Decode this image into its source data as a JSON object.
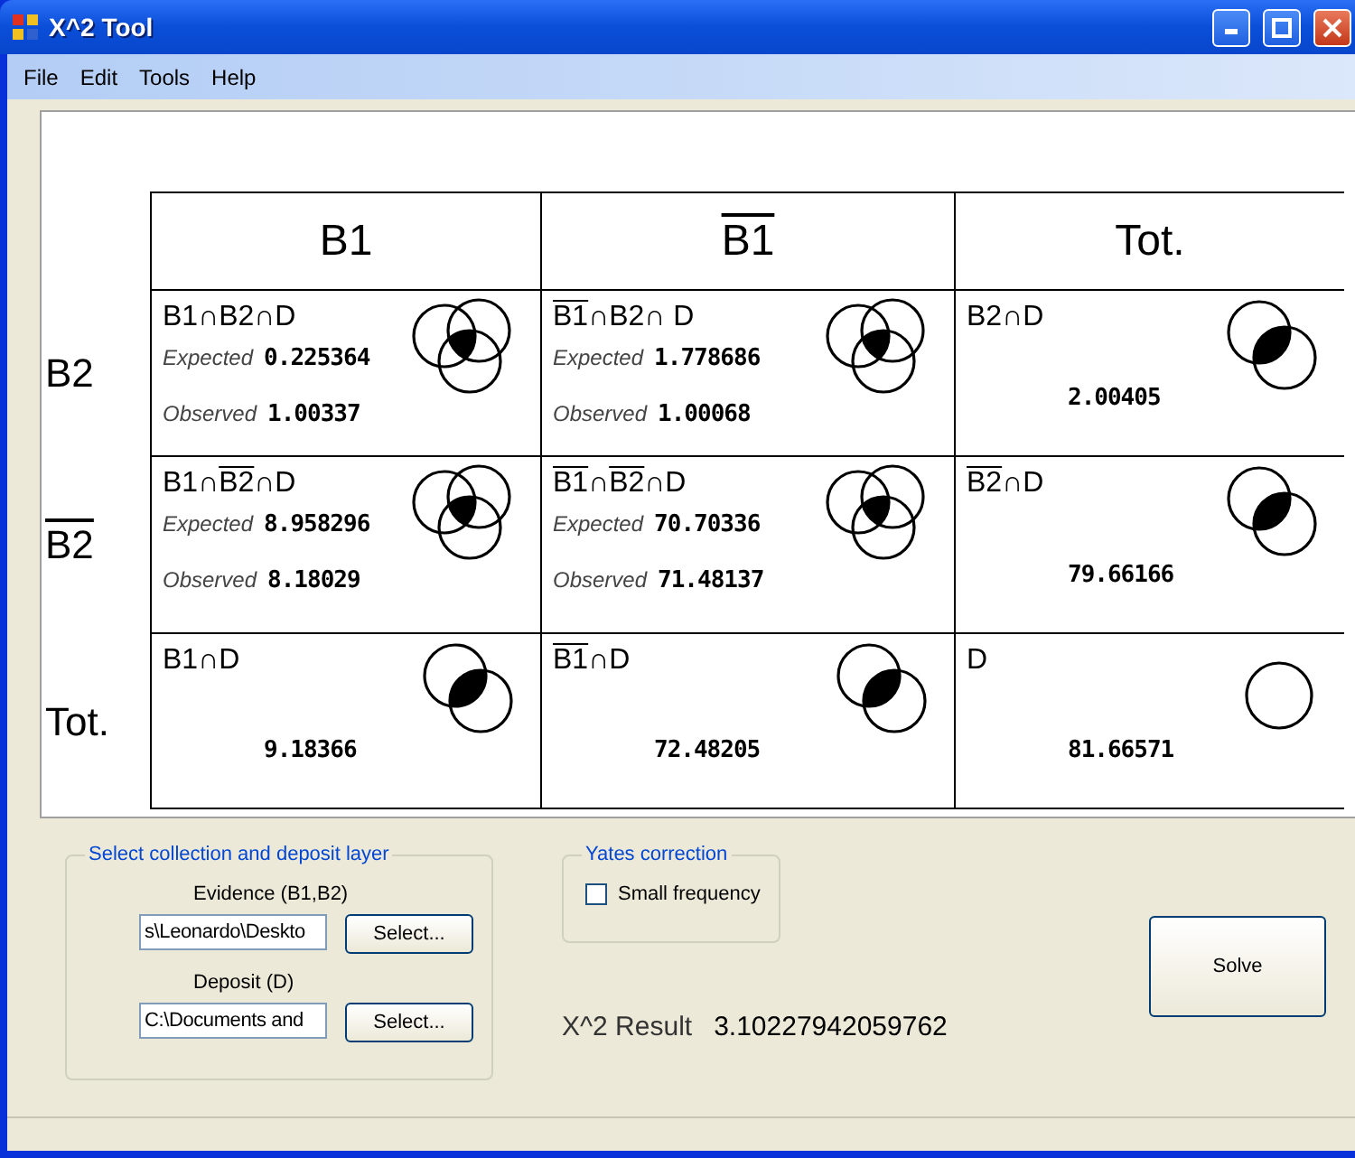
{
  "window": {
    "title": "X^2 Tool"
  },
  "menu": [
    "File",
    "Edit",
    "Tools",
    "Help"
  ],
  "column_headers": [
    [
      {
        "text": "B1"
      }
    ],
    [
      {
        "text": "B1",
        "bar": true
      }
    ],
    [
      {
        "text": "Tot."
      }
    ]
  ],
  "table": {
    "rows": [
      {
        "label": [
          {
            "text": "B2"
          }
        ],
        "cells": [
          {
            "kind": "observed",
            "diagram": {
              "kind": "triple"
            },
            "label": [
              {
                "text": "B1∩B2∩D"
              }
            ],
            "expected_label": "Expected",
            "expected": "0.225364",
            "observed_label": "Observed",
            "observed": "1.00337"
          },
          {
            "kind": "observed",
            "diagram": {
              "kind": "triple"
            },
            "label": [
              {
                "text": "B1",
                "bar": true
              },
              {
                "text": "∩B2∩ D"
              }
            ],
            "expected_label": "Expected",
            "expected": "1.778686",
            "observed_label": "Observed",
            "observed": "1.00068"
          },
          {
            "kind": "total",
            "diagram": {
              "kind": "double"
            },
            "label": [
              {
                "text": "B2∩D"
              }
            ],
            "value": "2.00405"
          }
        ]
      },
      {
        "label": [
          {
            "text": "B2",
            "bar": true
          }
        ],
        "cells": [
          {
            "kind": "observed",
            "diagram": {
              "kind": "triple"
            },
            "label": [
              {
                "text": "B1∩"
              },
              {
                "text": "B2",
                "bar": true
              },
              {
                "text": "∩D"
              }
            ],
            "expected_label": "Expected",
            "expected": "8.958296",
            "observed_label": "Observed",
            "observed": "8.18029"
          },
          {
            "kind": "observed",
            "diagram": {
              "kind": "triple"
            },
            "label": [
              {
                "text": "B1",
                "bar": true
              },
              {
                "text": "∩"
              },
              {
                "text": "B2",
                "bar": true
              },
              {
                "text": "∩D"
              }
            ],
            "expected_label": "Expected",
            "expected": "70.70336",
            "observed_label": "Observed",
            "observed": "71.48137"
          },
          {
            "kind": "total",
            "diagram": {
              "kind": "double"
            },
            "label": [
              {
                "text": "B2",
                "bar": true
              },
              {
                "text": "∩D"
              }
            ],
            "value": "79.66166"
          }
        ]
      },
      {
        "label": [
          {
            "text": "Tot."
          }
        ],
        "cells": [
          {
            "kind": "total",
            "diagram": {
              "kind": "double"
            },
            "label": [
              {
                "text": "B1∩D"
              }
            ],
            "value": "9.18366"
          },
          {
            "kind": "total",
            "diagram": {
              "kind": "double"
            },
            "label": [
              {
                "text": "B1",
                "bar": true
              },
              {
                "text": "∩D"
              }
            ],
            "value": "72.48205"
          },
          {
            "kind": "total",
            "diagram": {
              "kind": "single"
            },
            "label": [
              {
                "text": "D"
              }
            ],
            "value": "81.66571"
          }
        ]
      }
    ]
  },
  "layer_group": {
    "title": "Select collection and deposit layer",
    "fields": [
      {
        "label": "Evidence (B1,B2)",
        "value": "s\\Leonardo\\Deskto",
        "button": "Select..."
      },
      {
        "label": "Deposit (D)",
        "value": "C:\\Documents and",
        "button": "Select..."
      }
    ]
  },
  "yates_group": {
    "title": "Yates correction",
    "checkbox": {
      "label": "Small frequency",
      "checked": false
    }
  },
  "result": {
    "label": "X^2 Result",
    "value": "3.10227942059762"
  },
  "solve_button": "Solve"
}
